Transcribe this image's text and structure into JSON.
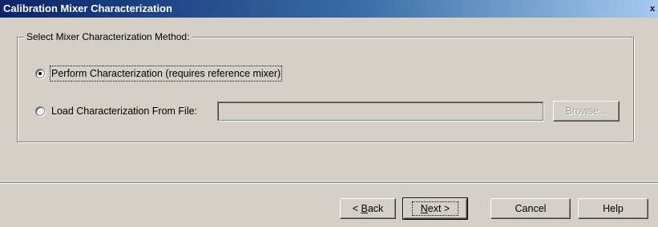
{
  "window": {
    "title": "Calibration Mixer Characterization",
    "close_glyph": "x"
  },
  "group": {
    "label": "Select Mixer Characterization Method:"
  },
  "options": {
    "perform": {
      "label": "Perform Characterization (requires reference mixer)",
      "selected": true
    },
    "load": {
      "label": "Load Characterization From File:",
      "selected": false
    }
  },
  "file": {
    "value": "",
    "browse_label": "Browse..."
  },
  "buttons": {
    "back_prefix": "< ",
    "back_mnemonic": "B",
    "back_rest": "ack",
    "next_mnemonic": "N",
    "next_rest": "ext >",
    "cancel_label": "Cancel",
    "help_label": "Help"
  },
  "icons": {
    "close": "close-icon",
    "radio_selected": "radio-selected-icon",
    "radio_unselected": "radio-unselected-icon"
  },
  "colors": {
    "titlebar_start": "#0a246a",
    "titlebar_end": "#a6caf0",
    "dialog_face": "#d4d0c8"
  }
}
